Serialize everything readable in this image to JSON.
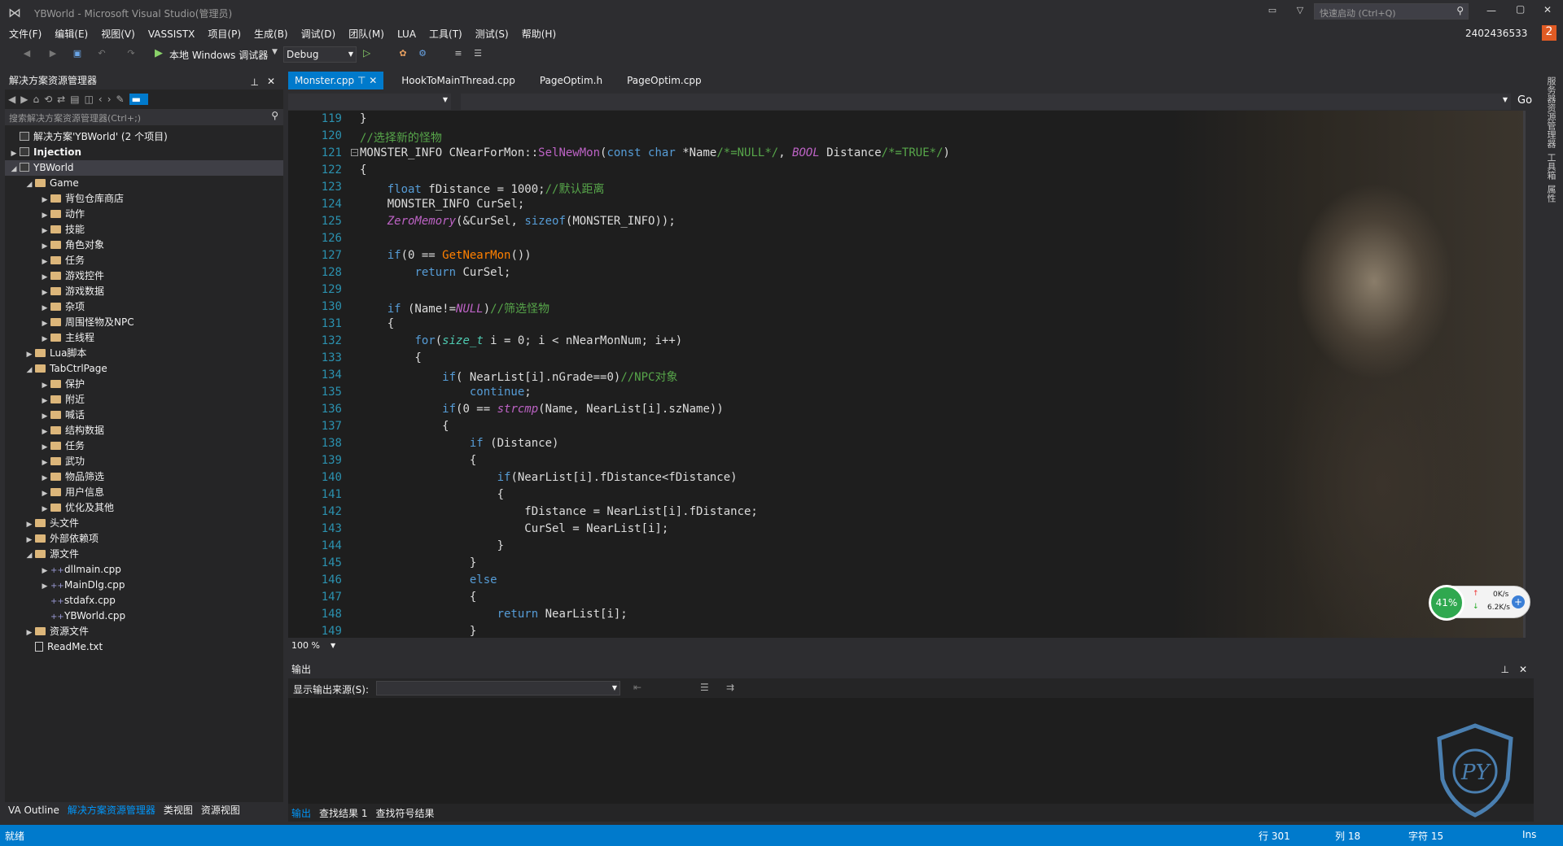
{
  "window": {
    "title": "YBWorld - Microsoft Visual Studio(管理员)",
    "quick_launch": "快速启动 (Ctrl+Q)",
    "user": "2402436533",
    "badge": "2"
  },
  "menu": [
    "文件(F)",
    "编辑(E)",
    "视图(V)",
    "VASSISTX",
    "项目(P)",
    "生成(B)",
    "调试(D)",
    "团队(M)",
    "LUA",
    "工具(T)",
    "测试(S)",
    "帮助(H)"
  ],
  "toolbar": {
    "debugger": "本地 Windows 调试器",
    "config": "Debug"
  },
  "solution_explorer": {
    "title": "解决方案资源管理器",
    "search_placeholder": "搜索解决方案资源管理器(Ctrl+;)",
    "rows": [
      {
        "label": "解决方案'YBWorld' (2 个项目)",
        "indent": 0,
        "icon": "solution"
      },
      {
        "label": "Injection",
        "indent": 0,
        "icon": "project",
        "arrow": "▶",
        "bold": true
      },
      {
        "label": "YBWorld",
        "indent": 0,
        "icon": "project",
        "arrow": "◢",
        "selected": true
      },
      {
        "label": "Game",
        "indent": 1,
        "icon": "folder",
        "arrow": "◢"
      },
      {
        "label": "背包仓库商店",
        "indent": 2,
        "icon": "folder",
        "arrow": "▶"
      },
      {
        "label": "动作",
        "indent": 2,
        "icon": "folder",
        "arrow": "▶"
      },
      {
        "label": "技能",
        "indent": 2,
        "icon": "folder",
        "arrow": "▶"
      },
      {
        "label": "角色对象",
        "indent": 2,
        "icon": "folder",
        "arrow": "▶"
      },
      {
        "label": "任务",
        "indent": 2,
        "icon": "folder",
        "arrow": "▶"
      },
      {
        "label": "游戏控件",
        "indent": 2,
        "icon": "folder",
        "arrow": "▶"
      },
      {
        "label": "游戏数据",
        "indent": 2,
        "icon": "folder",
        "arrow": "▶"
      },
      {
        "label": "杂项",
        "indent": 2,
        "icon": "folder",
        "arrow": "▶"
      },
      {
        "label": "周围怪物及NPC",
        "indent": 2,
        "icon": "folder",
        "arrow": "▶"
      },
      {
        "label": "主线程",
        "indent": 2,
        "icon": "folder",
        "arrow": "▶"
      },
      {
        "label": "Lua脚本",
        "indent": 1,
        "icon": "folder",
        "arrow": "▶"
      },
      {
        "label": "TabCtrlPage",
        "indent": 1,
        "icon": "folder",
        "arrow": "◢"
      },
      {
        "label": "保护",
        "indent": 2,
        "icon": "folder",
        "arrow": "▶"
      },
      {
        "label": "附近",
        "indent": 2,
        "icon": "folder",
        "arrow": "▶"
      },
      {
        "label": "喊话",
        "indent": 2,
        "icon": "folder",
        "arrow": "▶"
      },
      {
        "label": "结构数据",
        "indent": 2,
        "icon": "folder",
        "arrow": "▶"
      },
      {
        "label": "任务",
        "indent": 2,
        "icon": "folder",
        "arrow": "▶"
      },
      {
        "label": "武功",
        "indent": 2,
        "icon": "folder",
        "arrow": "▶"
      },
      {
        "label": "物品筛选",
        "indent": 2,
        "icon": "folder",
        "arrow": "▶"
      },
      {
        "label": "用户信息",
        "indent": 2,
        "icon": "folder",
        "arrow": "▶"
      },
      {
        "label": "优化及其他",
        "indent": 2,
        "icon": "folder",
        "arrow": "▶"
      },
      {
        "label": "头文件",
        "indent": 1,
        "icon": "folder",
        "arrow": "▶"
      },
      {
        "label": "外部依赖项",
        "indent": 1,
        "icon": "folder",
        "arrow": "▶"
      },
      {
        "label": "源文件",
        "indent": 1,
        "icon": "folder",
        "arrow": "◢"
      },
      {
        "label": "dllmain.cpp",
        "indent": 2,
        "icon": "cpp",
        "arrow": "▶"
      },
      {
        "label": "MainDlg.cpp",
        "indent": 2,
        "icon": "cpp",
        "arrow": "▶"
      },
      {
        "label": "stdafx.cpp",
        "indent": 2,
        "icon": "cpp"
      },
      {
        "label": "YBWorld.cpp",
        "indent": 2,
        "icon": "cpp"
      },
      {
        "label": "资源文件",
        "indent": 1,
        "icon": "folder",
        "arrow": "▶"
      },
      {
        "label": "ReadMe.txt",
        "indent": 1,
        "icon": "file"
      }
    ],
    "bottom_tabs": [
      "VA Outline",
      "解决方案资源管理器",
      "类视图",
      "资源视图"
    ]
  },
  "tabs": [
    {
      "label": "Monster.cpp",
      "active": true
    },
    {
      "label": "HookToMainThread.cpp"
    },
    {
      "label": "PageOptim.h"
    },
    {
      "label": "PageOptim.cpp"
    }
  ],
  "editor": {
    "zoom": "100 %",
    "go": "Go",
    "lines": [
      {
        "n": "119",
        "html": "}"
      },
      {
        "n": "120",
        "html": "<span class='cm'>//选择新的怪物</span>"
      },
      {
        "n": "121",
        "html": "MONSTER_INFO CNearForMon::<span class='mc'>SelNewMon</span>(<span class='kw'>const</span> <span class='kw'>char</span> *Name<span class='cm'>/*=NULL*/</span>, <span class='mc it'>BOOL</span> Distance<span class='cm'>/*=TRUE*/</span>)",
        "collapse": true
      },
      {
        "n": "122",
        "html": "{"
      },
      {
        "n": "123",
        "html": "    <span class='kw'>float</span> fDistance = 1000;<span class='cm'>//默认距离</span>"
      },
      {
        "n": "124",
        "html": "    MONSTER_INFO CurSel;"
      },
      {
        "n": "125",
        "html": "    <span class='mc it'>ZeroMemory</span>(&amp;CurSel, <span class='kw'>sizeof</span>(MONSTER_INFO));"
      },
      {
        "n": "126",
        "html": ""
      },
      {
        "n": "127",
        "html": "    <span class='kw'>if</span>(0 == <span class='fn'>GetNearMon</span>())"
      },
      {
        "n": "128",
        "html": "        <span class='kw'>return</span> CurSel;"
      },
      {
        "n": "129",
        "html": ""
      },
      {
        "n": "130",
        "html": "    <span class='kw'>if</span> (Name!=<span class='mc it'>NULL</span>)<span class='cm'>//筛选怪物</span>"
      },
      {
        "n": "131",
        "html": "    {"
      },
      {
        "n": "132",
        "html": "        <span class='kw'>for</span>(<span class='ty it'>size_t</span> i = 0; i &lt; nNearMonNum; i++)"
      },
      {
        "n": "133",
        "html": "        {"
      },
      {
        "n": "134",
        "html": "            <span class='kw'>if</span>( NearList[i].nGrade==0)<span class='cm'>//NPC对象</span>"
      },
      {
        "n": "135",
        "html": "                <span class='kw'>continue</span>;"
      },
      {
        "n": "136",
        "html": "            <span class='kw'>if</span>(0 == <span class='mc it'>strcmp</span>(Name, NearList[i].szName))"
      },
      {
        "n": "137",
        "html": "            {"
      },
      {
        "n": "138",
        "html": "                <span class='kw'>if</span> (Distance)"
      },
      {
        "n": "139",
        "html": "                {"
      },
      {
        "n": "140",
        "html": "                    <span class='kw'>if</span>(NearList[i].fDistance&lt;fDistance)"
      },
      {
        "n": "141",
        "html": "                    {"
      },
      {
        "n": "142",
        "html": "                        fDistance = NearList[i].fDistance;"
      },
      {
        "n": "143",
        "html": "                        CurSel = NearList[i];"
      },
      {
        "n": "144",
        "html": "                    }"
      },
      {
        "n": "145",
        "html": "                }"
      },
      {
        "n": "146",
        "html": "                <span class='kw'>else</span>"
      },
      {
        "n": "147",
        "html": "                {"
      },
      {
        "n": "148",
        "html": "                    <span class='kw'>return</span> NearList[i];"
      },
      {
        "n": "149",
        "html": "                }"
      }
    ]
  },
  "output": {
    "title": "输出",
    "source_label": "显示输出来源(S):",
    "bottom_tabs": [
      "输出",
      "查找结果 1",
      "查找符号结果"
    ]
  },
  "net_widget": {
    "percent": "41%",
    "up": "0K/s",
    "down": "6.2K/s"
  },
  "right_rail": [
    "服务器资源管理器",
    "工具箱",
    "属性"
  ],
  "status": {
    "ready": "就绪",
    "line": "行 301",
    "col": "列 18",
    "char": "字符 15",
    "mode": "Ins"
  }
}
